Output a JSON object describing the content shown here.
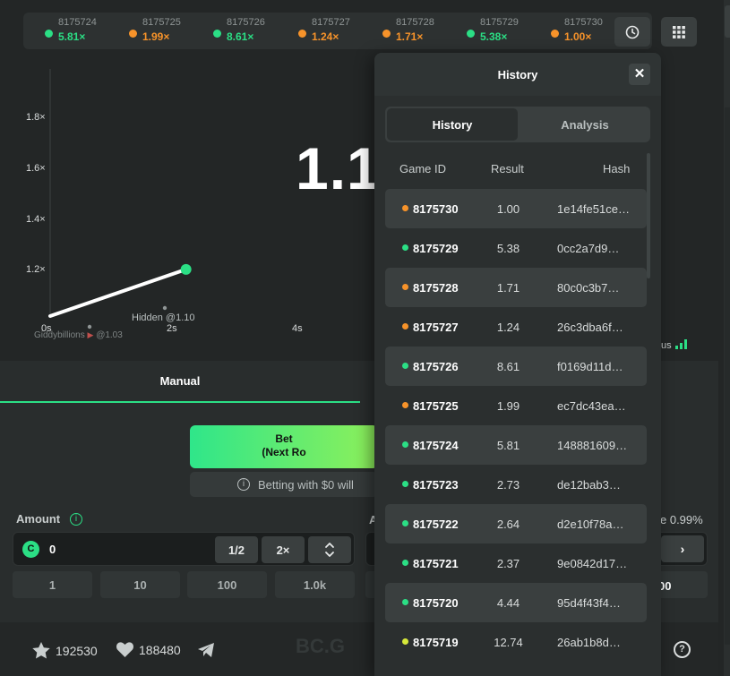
{
  "recent_games": [
    {
      "id": "8175724",
      "value": "5.81×",
      "color": "#2bdf85"
    },
    {
      "id": "8175725",
      "value": "1.99×",
      "color": "#f7932a"
    },
    {
      "id": "8175726",
      "value": "8.61×",
      "color": "#2bdf85"
    },
    {
      "id": "8175727",
      "value": "1.24×",
      "color": "#f7932a"
    },
    {
      "id": "8175728",
      "value": "1.71×",
      "color": "#f7932a"
    },
    {
      "id": "8175729",
      "value": "5.38×",
      "color": "#2bdf85"
    },
    {
      "id": "8175730",
      "value": "1.00×",
      "color": "#f7932a"
    }
  ],
  "chart_data": {
    "type": "line",
    "multiplier_display": "1.1",
    "y_ticks": [
      "1.8×",
      "1.6×",
      "1.4×",
      "1.2×"
    ],
    "x_ticks": [
      "0s",
      "2s",
      "4s"
    ],
    "ylim": [
      1.0,
      1.9
    ],
    "xlim": [
      0,
      6
    ],
    "series": [
      {
        "x": [
          0,
          2.6
        ],
        "y": [
          1.0,
          1.17
        ]
      }
    ],
    "annotations": [
      "Hidden @1.10",
      "Giddybillions",
      "@1.03"
    ]
  },
  "status_label": "tus",
  "bet": {
    "tab_manual": "Manual",
    "bet_button_line1": "Bet",
    "bet_button_line2": "(Next Ro",
    "note": "Betting with $0 will",
    "amount_label": "Amount",
    "amount_value": "0",
    "half_label": "1/2",
    "double_label": "2×",
    "quick_amounts": [
      "1",
      "10",
      "100",
      "1.0k"
    ],
    "auto_label": "A",
    "edge_label": "e 0.99%",
    "auto_quick_value": "00"
  },
  "footer": {
    "stars": "192530",
    "likes": "188480",
    "brand": "BC.G"
  },
  "history": {
    "title": "History",
    "tabs": [
      "History",
      "Analysis"
    ],
    "columns": [
      "Game ID",
      "Result",
      "Hash"
    ],
    "rows": [
      {
        "game_id": "8175730",
        "result": "1.00",
        "hash": "1e14fe51ce…",
        "color": "#f7932a"
      },
      {
        "game_id": "8175729",
        "result": "5.38",
        "hash": "0cc2a7d9…",
        "color": "#2bdf85"
      },
      {
        "game_id": "8175728",
        "result": "1.71",
        "hash": "80c0c3b7…",
        "color": "#f7932a"
      },
      {
        "game_id": "8175727",
        "result": "1.24",
        "hash": "26c3dba6f…",
        "color": "#f7932a"
      },
      {
        "game_id": "8175726",
        "result": "8.61",
        "hash": "f0169d11d…",
        "color": "#2bdf85"
      },
      {
        "game_id": "8175725",
        "result": "1.99",
        "hash": "ec7dc43ea…",
        "color": "#f7932a"
      },
      {
        "game_id": "8175724",
        "result": "5.81",
        "hash": "148881609…",
        "color": "#2bdf85"
      },
      {
        "game_id": "8175723",
        "result": "2.73",
        "hash": "de12bab3…",
        "color": "#2bdf85"
      },
      {
        "game_id": "8175722",
        "result": "2.64",
        "hash": "d2e10f78a…",
        "color": "#2bdf85"
      },
      {
        "game_id": "8175721",
        "result": "2.37",
        "hash": "9e0842d17…",
        "color": "#2bdf85"
      },
      {
        "game_id": "8175720",
        "result": "4.44",
        "hash": "95d4f43f4…",
        "color": "#2bdf85"
      },
      {
        "game_id": "8175719",
        "result": "12.74",
        "hash": "26ab1b8d…",
        "color": "#d6e83a"
      }
    ]
  }
}
